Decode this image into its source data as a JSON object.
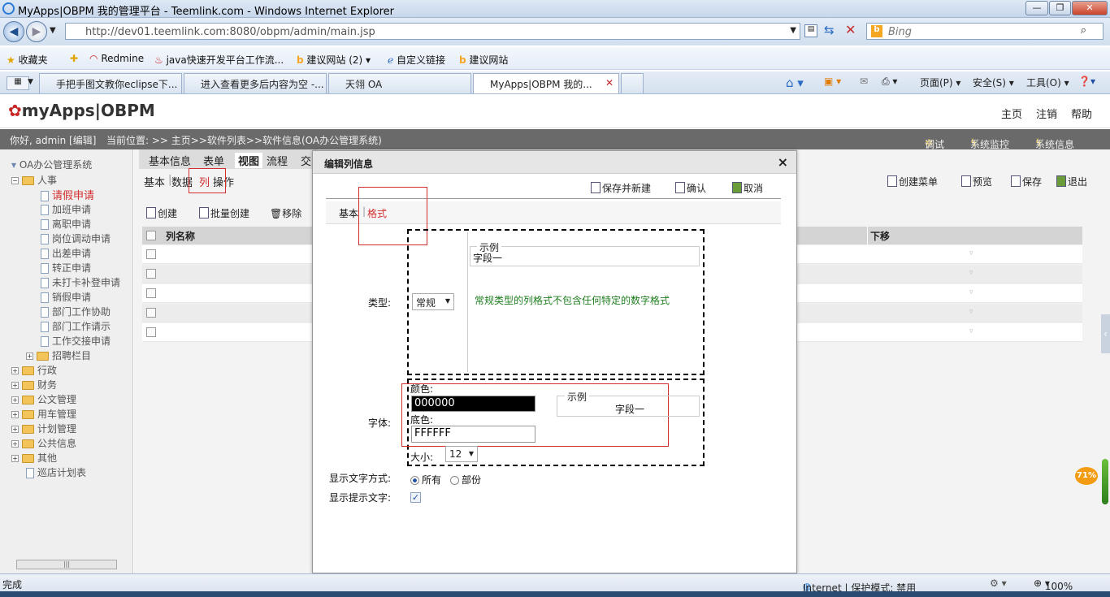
{
  "browser": {
    "window_title": "MyApps|OBPM 我的管理平台 - Teemlink.com - Windows Internet Explorer",
    "address": "http://dev01.teemlink.com:8080/obpm/admin/main.jsp",
    "search_placeholder": "Bing",
    "favorites": [
      "收藏夹",
      "Redmine",
      "java快速开发平台工作流...",
      "建议网站 (2) ▾",
      "自定义链接",
      "建议网站"
    ],
    "tabs": [
      "手把手图文教你eclipse下...",
      "进入查看更多后内容为空 -...",
      "天翎 OA",
      "MyApps|OBPM 我的..."
    ],
    "commands": [
      "页面(P) ▾",
      "安全(S) ▾",
      "工具(O) ▾"
    ],
    "status": "完成",
    "zone": "Internet | 保护模式: 禁用",
    "zoom": "100%"
  },
  "app": {
    "logo_main": "myApps",
    "logo_sub": "OBPM",
    "header_links": [
      "主页",
      "注销",
      "帮助"
    ],
    "greeting": "你好, admin [编辑]",
    "breadcrumb": "当前位置: >> 主页>>软件列表>>软件信息(OA办公管理系统)",
    "strip_links": [
      "调试",
      "系统监控",
      "系统信息"
    ]
  },
  "tree": {
    "root": "OA办公管理系统",
    "hr": "人事",
    "hr_items": [
      "请假申请",
      "加班申请",
      "离职申请",
      "岗位调动申请",
      "出差申请",
      "转正申请",
      "未打卡补登申请",
      "销假申请",
      "部门工作协助",
      "部门工作请示",
      "工作交接申请"
    ],
    "recruit": "招聘栏目",
    "groups": [
      "行政",
      "财务",
      "公文管理",
      "用车管理",
      "计划管理",
      "公共信息",
      "其他"
    ],
    "last": "巡店计划表"
  },
  "content": {
    "main_tabs": [
      "基本信息",
      "表单",
      "视图",
      "流程",
      "交"
    ],
    "sub_tabs": [
      "基本",
      "数据",
      "列",
      "操作"
    ],
    "toolbar": [
      "创建",
      "批量创建",
      "移除"
    ],
    "right_toolbar": [
      "创建菜单",
      "预览",
      "保存",
      "退出"
    ],
    "col_name": "列名称",
    "col_down": "下移"
  },
  "dialog": {
    "title": "编辑列信息",
    "close": "×",
    "buttons": [
      "保存并新建",
      "确认",
      "取消"
    ],
    "tab_basic": "基本",
    "tab_format": "格式",
    "type_label": "类型:",
    "type_value": "常规",
    "sample_legend": "示例",
    "sample_text": "字段一",
    "type_desc": "常规类型的列格式不包含任何特定的数字格式",
    "font_label": "字体:",
    "color_label": "颜色:",
    "color_value": "000000",
    "bg_label": "底色:",
    "bg_value": "FFFFFF",
    "size_label": "大小:",
    "size_value": "12",
    "font_sample_legend": "示例",
    "font_sample_text": "字段一",
    "display_mode_label": "显示文字方式:",
    "display_all": "所有",
    "display_part": "部份",
    "show_tip_label": "显示提示文字:"
  },
  "side_badge": "71%"
}
